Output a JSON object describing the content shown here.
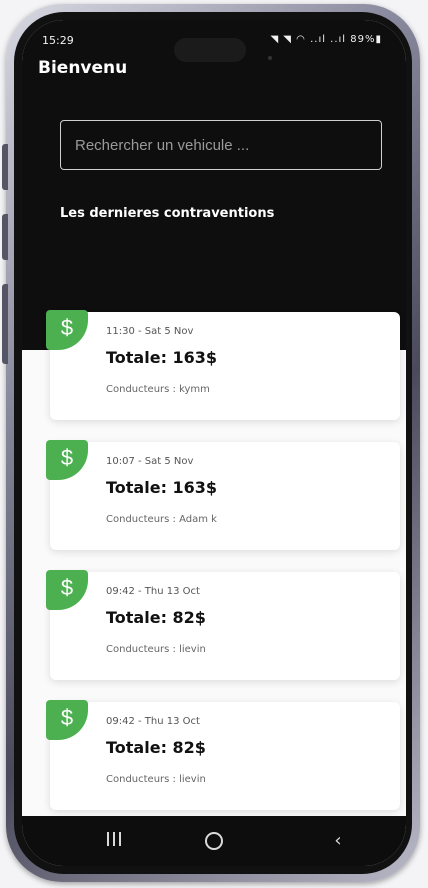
{
  "status_bar": {
    "time": "15:29",
    "icons_text": "◥ ◥ ◠ ..ıl ..ıl 89%▮"
  },
  "app": {
    "title": "Bienvenu"
  },
  "search": {
    "placeholder": "Rechercher un vehicule ..."
  },
  "section": {
    "title": "Les dernieres contraventions"
  },
  "contraventions": [
    {
      "icon": "dollar-icon",
      "symbol": "$",
      "datetime": "11:30 - Sat 5 Nov",
      "total": "Totale: 163$",
      "driver": "Conducteurs : kymm"
    },
    {
      "icon": "dollar-icon",
      "symbol": "$",
      "datetime": "10:07 - Sat 5 Nov",
      "total": "Totale: 163$",
      "driver": "Conducteurs : Adam k"
    },
    {
      "icon": "dollar-icon",
      "symbol": "$",
      "datetime": "09:42 - Thu 13 Oct",
      "total": "Totale: 82$",
      "driver": "Conducteurs : lievin"
    },
    {
      "icon": "dollar-icon",
      "symbol": "$",
      "datetime": "09:42 - Thu 13 Oct",
      "total": "Totale: 82$",
      "driver": "Conducteurs : lievin"
    }
  ],
  "nav": {
    "recent_icon": "recent-apps-icon",
    "home_icon": "home-icon",
    "back_icon": "back-icon",
    "back_glyph": "‹"
  },
  "colors": {
    "accent": "#4caf50",
    "header_bg": "#0e0e0e"
  }
}
